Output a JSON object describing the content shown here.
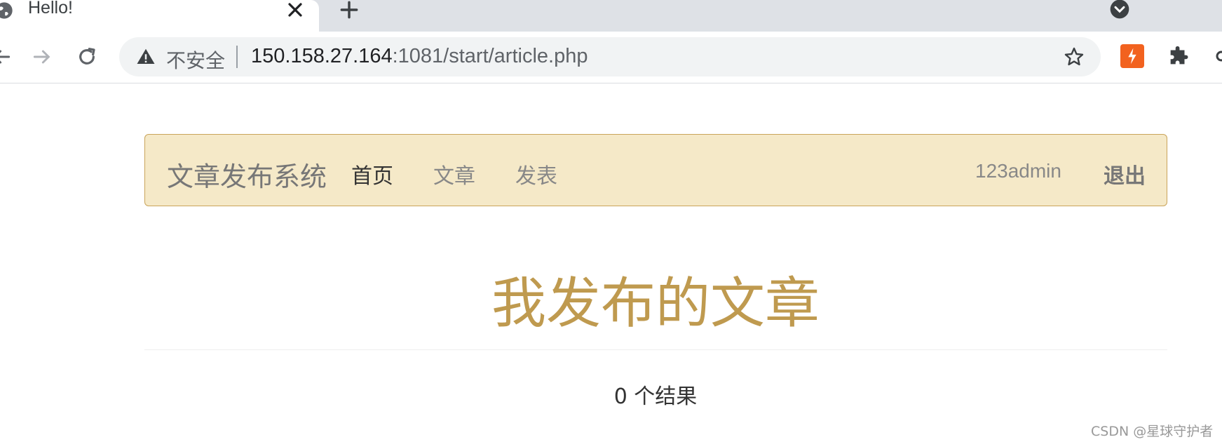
{
  "browser": {
    "tab_title": "Hello!",
    "security_label": "不安全",
    "url_host": "150.158.27.164",
    "url_rest": ":1081/start/article.php"
  },
  "navbar": {
    "brand": "文章发布系统",
    "links": [
      "首页",
      "文章",
      "发表"
    ],
    "active_link": "首页",
    "username": "123admin",
    "logout": "退出"
  },
  "main": {
    "title": "我发布的文章",
    "result_count": "0 个结果"
  },
  "watermark": "CSDN @星球守护者",
  "colors": {
    "navbar_bg": "#f5e9c8",
    "navbar_border": "#c9a45a",
    "title_color": "#bf9a4f",
    "extension_accent": "#f2621f"
  }
}
